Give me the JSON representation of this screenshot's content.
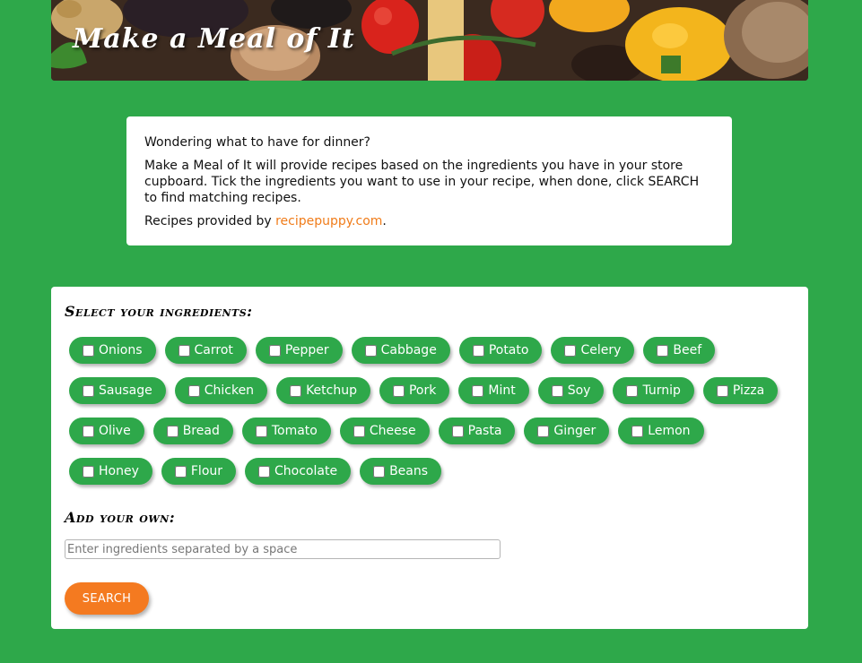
{
  "header": {
    "title": "Make a Meal of It"
  },
  "intro": {
    "question": "Wondering what to have for dinner?",
    "description": "Make a Meal of It will provide recipes based on the ingredients you have in your store cupboard. Tick the ingredients you want to use in your recipe, when done, click SEARCH to find matching recipes.",
    "credit_prefix": "Recipes provided by ",
    "credit_link": "recipepuppy.com",
    "credit_suffix": "."
  },
  "ingredients": {
    "heading": "Select your ingredients:",
    "rows": [
      [
        "Onions",
        "Carrot",
        "Pepper",
        "Cabbage",
        "Potato",
        "Celery",
        "Beef"
      ],
      [
        "Sausage",
        "Chicken",
        "Ketchup",
        "Pork",
        "Mint",
        "Soy",
        "Turnip",
        "Pizza"
      ],
      [
        "Olive",
        "Bread",
        "Tomato",
        "Cheese",
        "Pasta",
        "Ginger",
        "Lemon"
      ],
      [
        "Honey",
        "Flour",
        "Chocolate",
        "Beans"
      ]
    ]
  },
  "custom": {
    "heading": "Add your own:",
    "placeholder": "Enter ingredients separated by a space",
    "value": ""
  },
  "search": {
    "label": "SEARCH"
  },
  "colors": {
    "background": "#2ea84a",
    "chip": "#2ea84a",
    "accent": "#f47a20",
    "link": "#f07c1a"
  }
}
